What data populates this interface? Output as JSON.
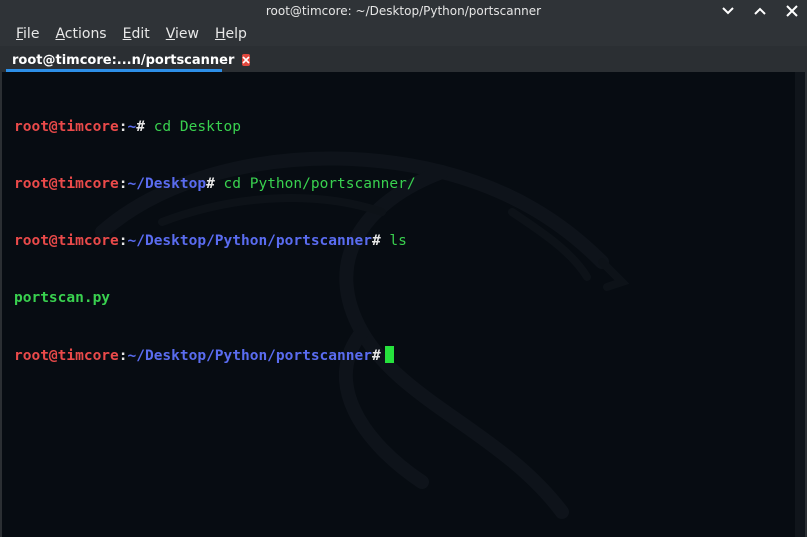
{
  "window": {
    "title": "root@timcore: ~/Desktop/Python/portscanner"
  },
  "menu": [
    {
      "label": "File",
      "mnemonic": "F",
      "rest": "ile"
    },
    {
      "label": "Actions",
      "mnemonic": "A",
      "rest": "ctions"
    },
    {
      "label": "Edit",
      "mnemonic": "E",
      "rest": "dit"
    },
    {
      "label": "View",
      "mnemonic": "V",
      "rest": "iew"
    },
    {
      "label": "Help",
      "mnemonic": "H",
      "rest": "elp"
    }
  ],
  "tab": {
    "label": "root@timcore:...n/portscanner"
  },
  "terminal": {
    "user": "root@timcore",
    "lines": [
      {
        "path": "~",
        "command": " cd Desktop"
      },
      {
        "path": "~/Desktop",
        "command": " cd Python/portscanner/"
      },
      {
        "path": "~/Desktop/Python/portscanner",
        "command": " ls"
      },
      {
        "output": "portscan.py"
      },
      {
        "path": "~/Desktop/Python/portscanner",
        "command": " "
      }
    ]
  },
  "colors": {
    "user": "#ea4a4a",
    "path": "#5a6cf0",
    "command": "#39d14f",
    "cursor": "#26e23d",
    "background": "#070c12",
    "tab_accent": "#2d8fe8"
  },
  "icons": {
    "minimize": "chevron-down-icon",
    "maximize": "chevron-up-icon",
    "close": "close-icon",
    "tab_close": "close-icon",
    "background": "dragon-logo"
  }
}
